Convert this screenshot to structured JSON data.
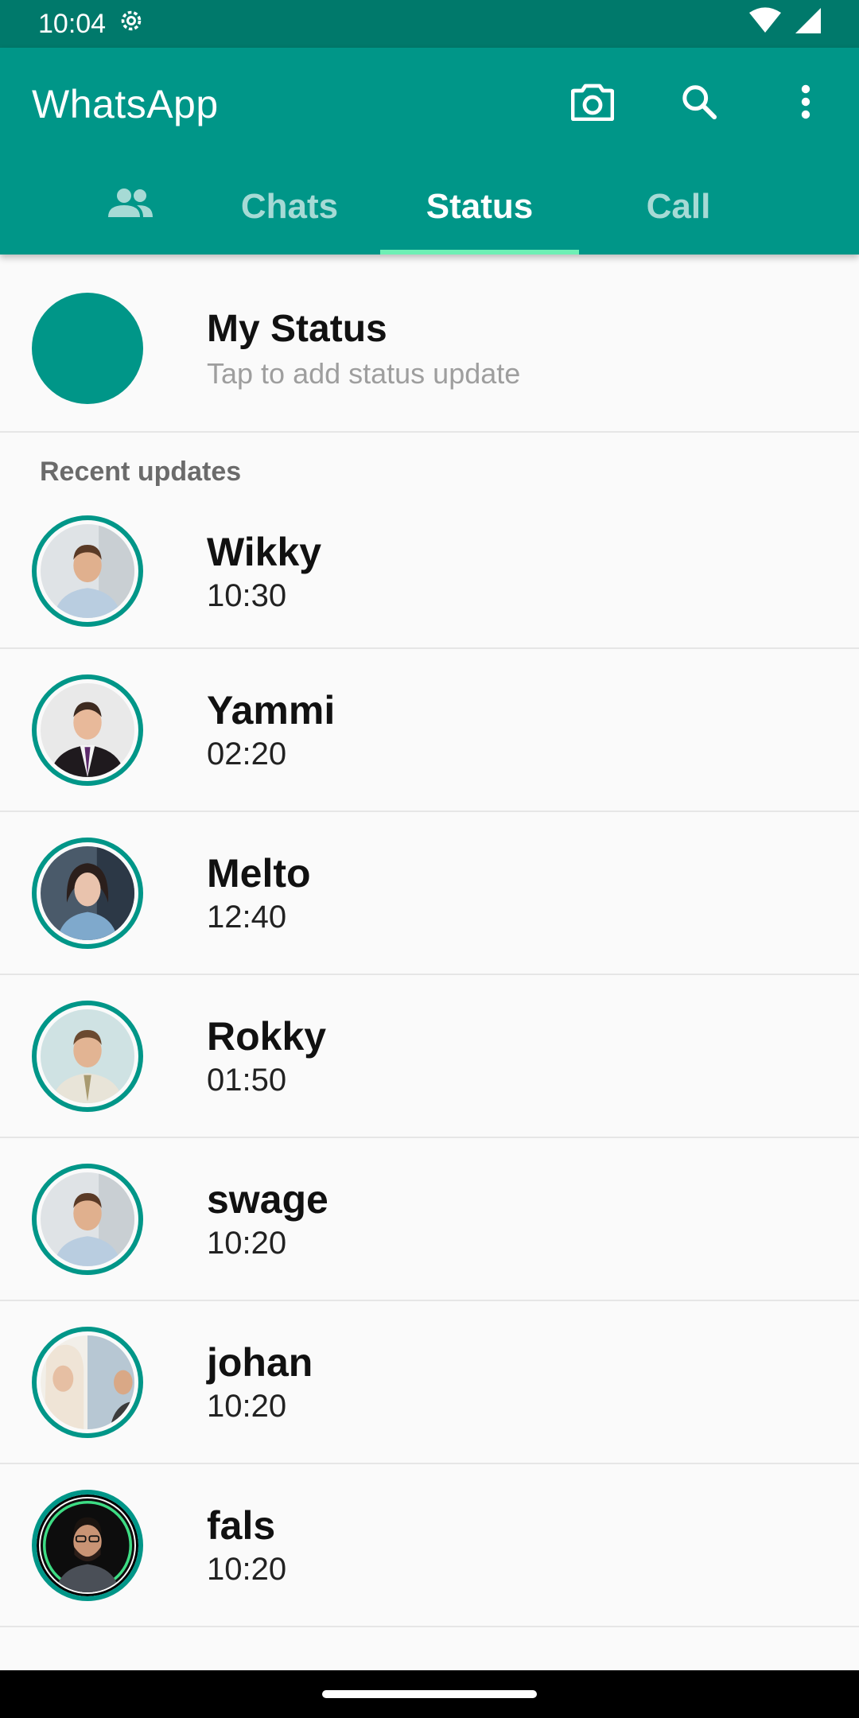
{
  "status_bar": {
    "time": "10:04"
  },
  "app_bar": {
    "title": "WhatsApp",
    "actions": [
      "camera-icon",
      "search-icon",
      "more-vert-icon"
    ]
  },
  "tabs": [
    {
      "icon": "community-icon"
    },
    {
      "label": "Chats"
    },
    {
      "label": "Status",
      "selected": true
    },
    {
      "label": "Call"
    }
  ],
  "my_status": {
    "title": "My Status",
    "subtitle": "Tap to add status update"
  },
  "section_label": "Recent updates",
  "statuses": [
    {
      "name": "Wikky",
      "time": "10:30"
    },
    {
      "name": "Yammi",
      "time": "02:20"
    },
    {
      "name": "Melto",
      "time": "12:40"
    },
    {
      "name": "Rokky",
      "time": "01:50"
    },
    {
      "name": "swage",
      "time": "10:20"
    },
    {
      "name": "johan",
      "time": "10:20"
    },
    {
      "name": "fals",
      "time": "10:20"
    }
  ],
  "colors": {
    "primary": "#009688",
    "primary_dark": "#00796b",
    "tab_indicator": "#6ef0b5"
  }
}
